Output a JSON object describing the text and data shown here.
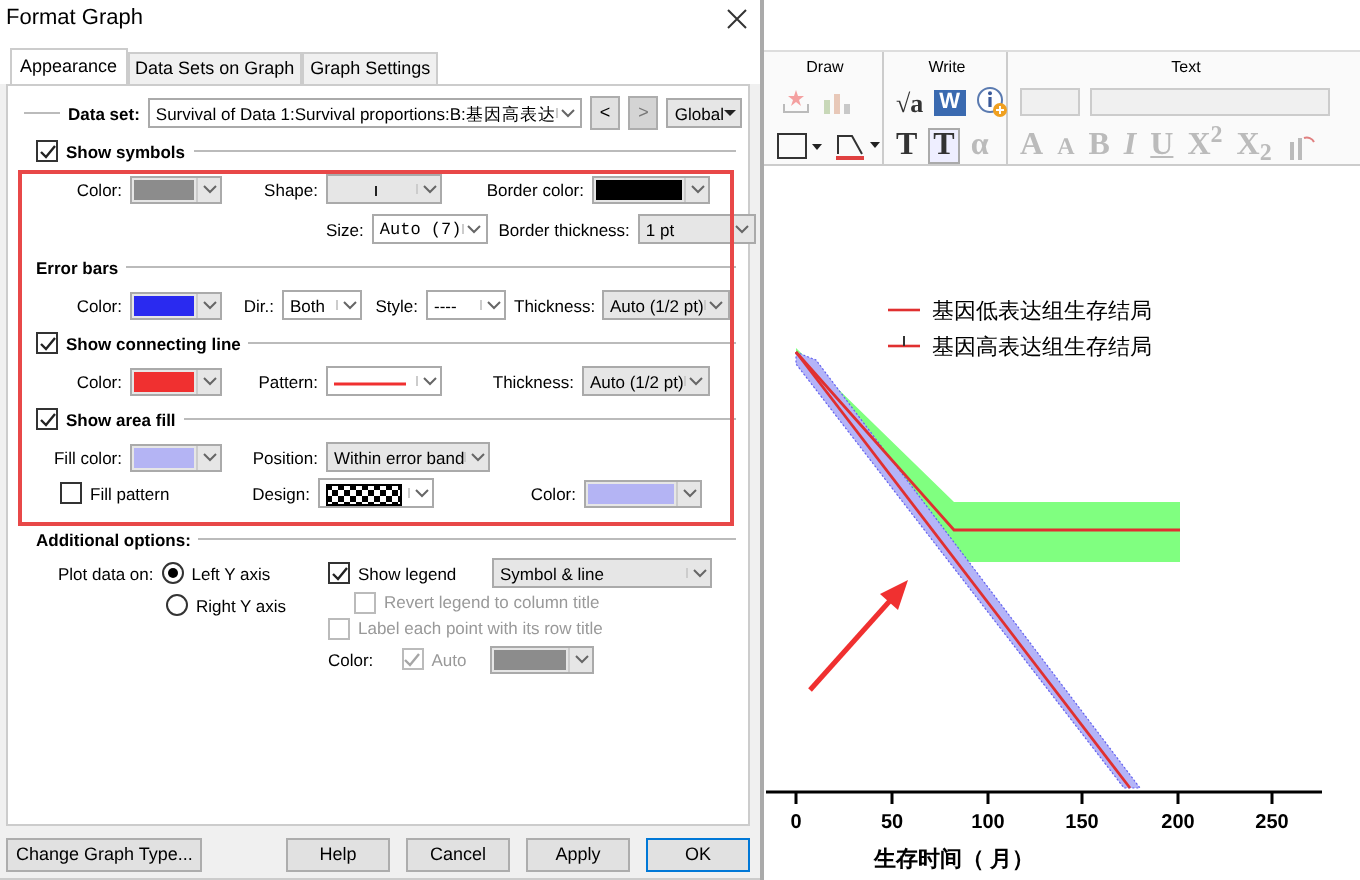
{
  "window": {
    "title": "Format Graph"
  },
  "tabs": [
    {
      "label": "Appearance",
      "selected": true
    },
    {
      "label": "Data Sets on Graph",
      "selected": false
    },
    {
      "label": "Graph Settings",
      "selected": false
    }
  ],
  "data_set": {
    "label": "Data set:",
    "value": "Survival of Data 1:Survival proportions:B:基因高表达",
    "prev": "<",
    "next": ">",
    "next_disabled": true,
    "scope": "Global"
  },
  "symbols": {
    "label": "Show symbols",
    "checked": true,
    "color_label": "Color:",
    "color": "#8c8c8c",
    "shape_label": "Shape:",
    "border_color_label": "Border color:",
    "border_swatch": {
      "color": "#000000"
    },
    "size_label": "Size:",
    "size_value": "Auto (7)",
    "border_thickness_label": "Border thickness:",
    "border_thickness_value": "1 pt"
  },
  "error_bars": {
    "title": "Error bars",
    "color_label": "Color:",
    "color": "#2a2af0",
    "dir_label": "Dir.:",
    "dir_value": "Both",
    "style_label": "Style:",
    "style_value": "----",
    "thickness_label": "Thickness:",
    "thickness_value": "Auto (1/2 pt)"
  },
  "connecting_line": {
    "label": "Show connecting line",
    "checked": true,
    "color_label": "Color:",
    "color": "#f03030",
    "pattern_label": "Pattern:",
    "thickness_label": "Thickness:",
    "thickness_value": "Auto (1/2 pt)"
  },
  "area_fill": {
    "label": "Show area fill",
    "checked": true,
    "fill_color_label": "Fill color:",
    "fill_swatch": {
      "color": "#b4b4f4"
    },
    "position_label": "Position:",
    "position_value": "Within error band",
    "fill_pattern": {
      "label": "Fill pattern",
      "checked": false
    },
    "design_label": "Design:",
    "color_label": "Color:",
    "color": "#b4b4f4"
  },
  "additional": {
    "title": "Additional options:",
    "plot_label": "Plot data on:",
    "axes": [
      {
        "label": "Left Y axis",
        "selected": true
      },
      {
        "label": "Right  Y axis",
        "selected": false
      }
    ],
    "show_legend": {
      "label": "Show legend",
      "checked": true
    },
    "legend_style": "Symbol & line",
    "revert": {
      "label": "Revert legend to column title",
      "checked": false,
      "disabled": true
    },
    "label_points": {
      "label": "Label each point with its row title",
      "checked": false,
      "disabled": true
    },
    "color_label": "Color:",
    "auto": {
      "label": "Auto",
      "checked": true,
      "disabled": true
    },
    "color": "#8c8c8c"
  },
  "buttons": [
    {
      "label": "Change Graph Type...",
      "default": false
    },
    {
      "label": "Help",
      "default": false
    },
    {
      "label": "Cancel",
      "default": false
    },
    {
      "label": "Apply",
      "default": false
    },
    {
      "label": "OK",
      "default": true
    }
  ],
  "ribbon": {
    "groups": [
      {
        "title": "Draw"
      },
      {
        "title": "Write"
      },
      {
        "title": "Text"
      }
    ],
    "write_row1": [
      {
        "label": "√a",
        "disabled": false
      },
      {
        "label": "W",
        "disabled": false
      }
    ],
    "write_row2": [
      {
        "label": "T",
        "disabled": false
      },
      {
        "label": "T",
        "disabled": false
      },
      {
        "label": "α",
        "disabled": true
      }
    ],
    "text_row2": [
      {
        "label": "A",
        "disabled": true
      },
      {
        "label": "A",
        "disabled": true
      },
      {
        "label": "B",
        "disabled": true
      },
      {
        "label": "I",
        "disabled": true
      },
      {
        "label": "U",
        "disabled": true
      },
      {
        "label": "X$^{2}$",
        "disabled": true
      },
      {
        "label": "X$_{2}$",
        "disabled": true
      }
    ]
  },
  "graph": {
    "legend": [
      {
        "label": "基因低表达组生存结局",
        "kind": "line"
      },
      {
        "label": "基因高表达组生存结局",
        "kind": "errorbar"
      }
    ],
    "x_ticks": [
      "0",
      "50",
      "100",
      "150",
      "200",
      "250"
    ],
    "x_title": "生存时间（ 月）"
  }
}
